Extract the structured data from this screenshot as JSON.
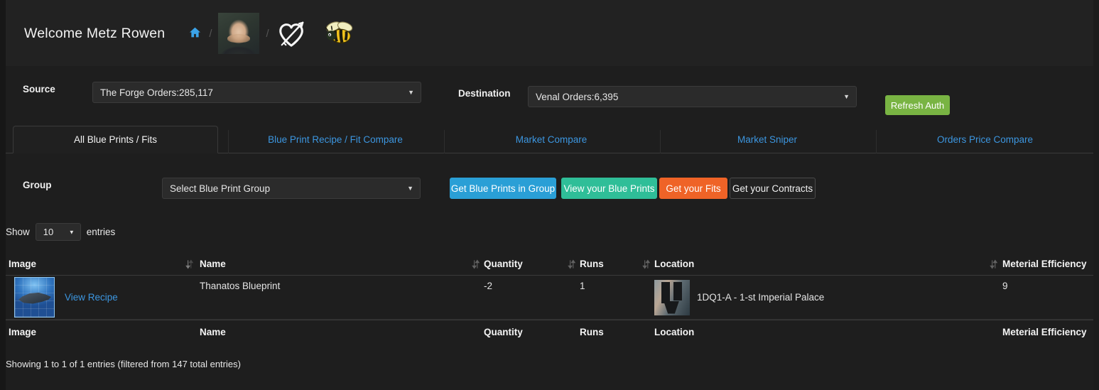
{
  "header": {
    "welcome_text": "Welcome Metz Rowen",
    "home_icon": "home-icon",
    "separator": "/",
    "avatar_icon": "user-avatar",
    "heart_icon": "heart-with-arrow-icon",
    "bee_icon": "bee-icon"
  },
  "filters": {
    "source_label": "Source",
    "source_value": "The Forge Orders:285,117",
    "destination_label": "Destination",
    "destination_value": "Venal Orders:6,395",
    "refresh_auth_label": "Refresh Auth",
    "caret": "▼"
  },
  "tabs": [
    {
      "label": "All Blue Prints / Fits",
      "active": true
    },
    {
      "label": "Blue Print Recipe / Fit Compare",
      "active": false
    },
    {
      "label": "Market Compare",
      "active": false
    },
    {
      "label": "Market Sniper",
      "active": false
    },
    {
      "label": "Orders Price Compare",
      "active": false
    }
  ],
  "group": {
    "label": "Group",
    "select_value": "Select Blue Print Group",
    "buttons": [
      {
        "label": "Get Blue Prints in Group",
        "color": "#2a9fd6"
      },
      {
        "label": "View your Blue Prints",
        "color": "#2fbe98"
      },
      {
        "label": "Get your Fits",
        "color": "#ef6327"
      },
      {
        "label": "Get your Contracts",
        "color": "#222222"
      }
    ]
  },
  "show_entries": {
    "prefix": "Show",
    "value": "10",
    "suffix": "entries"
  },
  "table": {
    "columns": [
      "Image",
      "Name",
      "Quantity",
      "Runs",
      "Location",
      "Meterial Efficiency"
    ],
    "footer_columns": [
      "Image",
      "Name",
      "Quantity",
      "Runs",
      "Location",
      "Meterial Efficiency"
    ],
    "rows": [
      {
        "image_icon": "blueprint-thumbnail",
        "view_recipe_label": "View Recipe",
        "name": "Thanatos Blueprint",
        "quantity": "-2",
        "runs": "1",
        "location_icon": "station-thumbnail",
        "location": "1DQ1-A - 1-st Imperial Palace",
        "material_efficiency": "9"
      }
    ],
    "info": "Showing 1 to 1 of 1 entries (filtered from 147 total entries)"
  },
  "colors": {
    "page_background": "#1e1e1e",
    "header_background": "#222222",
    "link_blue": "#3c96e0",
    "green": "#79b443",
    "blue": "#2a9fd6",
    "teal": "#2fbe98",
    "orange": "#ef6327"
  }
}
